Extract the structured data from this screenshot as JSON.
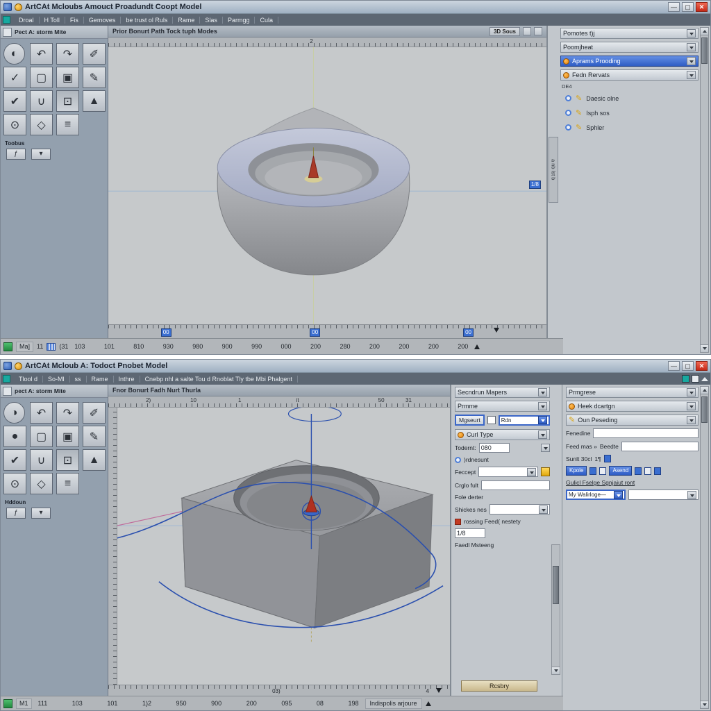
{
  "chrome": {
    "minimize": "—",
    "maximize": "▢",
    "close": "✕"
  },
  "icons": {
    "pencil": "✎"
  },
  "top_window": {
    "title": "ArtCAt Mcloubs Amouct Proadundt Coopt Model",
    "menu": [
      "Droal",
      "H Toll",
      "Fis",
      "Gemoves",
      "be trust ol Ruls",
      "Rame",
      "Slas",
      "Parmgg",
      "Cula"
    ],
    "toolbar_label": "Pect A: storm Mite",
    "toolbox": [
      "◐",
      "↶",
      "↷",
      "✐",
      "✓",
      "▢",
      "▣",
      "✎",
      "✔",
      "∪",
      "⊡",
      "▲",
      "⊙",
      "◇",
      "≡"
    ],
    "tools_label": "Toobus",
    "small_buttons": [
      "ƒ",
      "▾"
    ],
    "viewport_title": "Prior Bonurt Path Tock tuph Modes",
    "viewport_badge": "3D Sous",
    "ruler_top_label": "2",
    "edge_marker": "1/8",
    "bottom_markers": [
      "00",
      "00",
      "00"
    ],
    "side_tab_label": "a nb lst b",
    "right_panel": {
      "header1": "Pomotes t)j",
      "header2": "Poomjheat",
      "selected": "Aprams Prooding",
      "dd2": "Fedn Rervats",
      "caption": "DE4",
      "items": [
        "Daesic olne",
        "Isph sos",
        "Sphler"
      ]
    },
    "status": {
      "left": [
        "Ma]",
        "11",
        "(31"
      ],
      "numbers": [
        "103",
        "101",
        "810",
        "930",
        "980",
        "900",
        "990",
        "000",
        "200",
        "280",
        "200",
        "200",
        "200",
        "200"
      ]
    }
  },
  "bottom_window": {
    "title": "ArtCAt Mcloub A: Todoct Pnobet Model",
    "menu": [
      "Tlool d",
      "So-Ml",
      "ss",
      "Rame",
      "Inthre",
      "Cnebp nhl a salte Tou d Rnoblat Tly tbe Mbi Phalgent"
    ],
    "toolbar_label": "pect A: storm Mite",
    "toolbox": [
      "◑",
      "↶",
      "↷",
      "✐",
      "●",
      "▢",
      "▣",
      "✎",
      "✔",
      "∪",
      "⊡",
      "▲",
      "⊙",
      "◇",
      "≡"
    ],
    "tools_label": "Hddoun",
    "small_buttons": [
      "ƒ",
      "▾"
    ],
    "viewport_title": "Fnor Bonurt Fadh Nurt Thurla",
    "ruler_numbers": [
      "2)",
      "10",
      "1",
      "it",
      "50",
      "31"
    ],
    "bottom_marker": "03)",
    "bottom_marker2": "4",
    "mid_panel": {
      "header": "Secndrun Mapers",
      "sub": "Prmme",
      "measure_btn": "Mgseurt",
      "rdn": "Rdn",
      "curl": "Curl Type",
      "todernt_label": "Todernt:",
      "todernt_value": "080",
      "radio_label": ")rdnesunt",
      "feccept_label": "Feccept",
      "crglo_label": "Crglo fult",
      "fole_label": "Fole derter",
      "shickes_label": "Shickes nes",
      "rossing_label": "rossing Feed( nestety",
      "rossing_value": "1/8",
      "faedl_label": "Faedl Msteeng",
      "apply_btn": "Rcsbry"
    },
    "right_panel": {
      "header": "Prmgrese",
      "dd1": "Heek dcartgn",
      "dd2": "Oun Peseding",
      "fenedine": "Fenedine",
      "feed1": "Feed mas »",
      "feed2": "Beedte",
      "sunlt": "Sunlt 30cl",
      "sunlt_value": "1¶",
      "kpole": "Kpole",
      "asend": "Asend",
      "gulicl": "Gulicl Fselge Sgnjaiut ront",
      "walirloge": "My Walirloge—"
    },
    "status": {
      "left": "M1",
      "numbers": [
        "111",
        "103",
        "101",
        "1)2",
        "950",
        "900",
        "200",
        "095",
        "08",
        "198"
      ],
      "text": "Indispolis arjoure"
    }
  }
}
